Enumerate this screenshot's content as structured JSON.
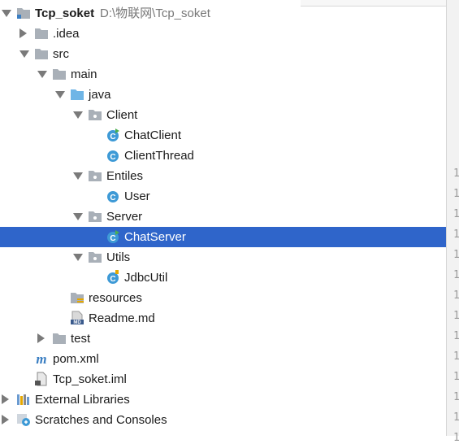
{
  "project": {
    "name": "Tcp_soket",
    "path": "D:\\物联网\\Tcp_soket"
  },
  "tree": [
    {
      "label": "Tcp_soket",
      "hint": "D:\\物联网\\Tcp_soket",
      "depth": 0,
      "arrow": "expanded",
      "icon": "project-folder-icon",
      "bold": true
    },
    {
      "label": ".idea",
      "depth": 1,
      "arrow": "collapsed",
      "icon": "folder-icon"
    },
    {
      "label": "src",
      "depth": 1,
      "arrow": "expanded",
      "icon": "folder-icon"
    },
    {
      "label": "main",
      "depth": 2,
      "arrow": "expanded",
      "icon": "folder-icon"
    },
    {
      "label": "java",
      "depth": 3,
      "arrow": "expanded",
      "icon": "source-folder-icon"
    },
    {
      "label": "Client",
      "depth": 4,
      "arrow": "expanded",
      "icon": "package-icon"
    },
    {
      "label": "ChatClient",
      "depth": 5,
      "arrow": "none",
      "icon": "java-class-run-icon"
    },
    {
      "label": "ClientThread",
      "depth": 5,
      "arrow": "none",
      "icon": "java-class-icon"
    },
    {
      "label": "Entiles",
      "depth": 4,
      "arrow": "expanded",
      "icon": "package-icon"
    },
    {
      "label": "User",
      "depth": 5,
      "arrow": "none",
      "icon": "java-class-icon"
    },
    {
      "label": "Server",
      "depth": 4,
      "arrow": "expanded",
      "icon": "package-icon"
    },
    {
      "label": "ChatServer",
      "depth": 5,
      "arrow": "none",
      "icon": "java-class-run-icon",
      "selected": true
    },
    {
      "label": "Utils",
      "depth": 4,
      "arrow": "expanded",
      "icon": "package-icon"
    },
    {
      "label": "JdbcUtil",
      "depth": 5,
      "arrow": "none",
      "icon": "java-class-lock-icon"
    },
    {
      "label": "resources",
      "depth": 3,
      "arrow": "none",
      "icon": "resources-folder-icon"
    },
    {
      "label": "Readme.md",
      "depth": 3,
      "arrow": "none",
      "icon": "markdown-file-icon"
    },
    {
      "label": "test",
      "depth": 2,
      "arrow": "collapsed",
      "icon": "folder-icon"
    },
    {
      "label": "pom.xml",
      "depth": 1,
      "arrow": "none",
      "icon": "maven-icon"
    },
    {
      "label": "Tcp_soket.iml",
      "depth": 1,
      "arrow": "none",
      "icon": "iml-file-icon"
    },
    {
      "label": "External Libraries",
      "depth": 0,
      "arrow": "collapsed",
      "icon": "libraries-icon"
    },
    {
      "label": "Scratches and Consoles",
      "depth": 0,
      "arrow": "collapsed",
      "icon": "scratches-icon"
    }
  ],
  "gutter": {
    "digit": "1"
  },
  "colors": {
    "selection": "#2f65ca",
    "folder": "#a9b0b8",
    "source_folder": "#6fb5e6",
    "class_circle": "#3e9ad6"
  }
}
